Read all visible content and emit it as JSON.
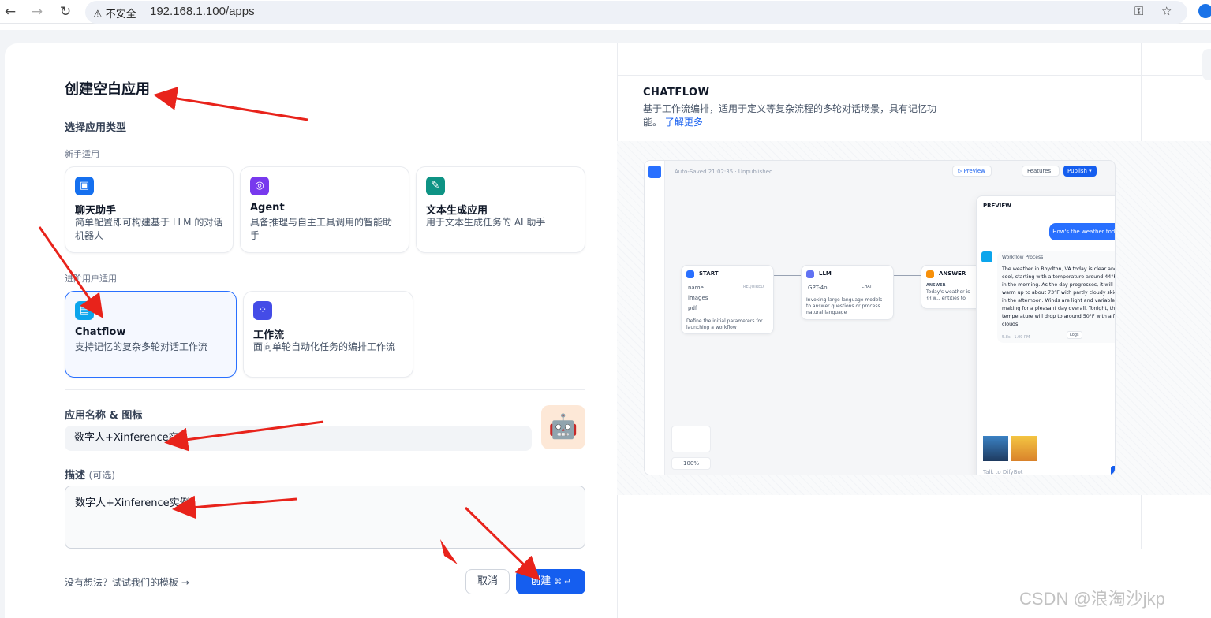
{
  "browser": {
    "warning": "不安全",
    "url": "192.168.1.100/apps"
  },
  "dialog": {
    "title": "创建空白应用",
    "select_type": "选择应用类型",
    "beginner_label": "新手适用",
    "advanced_label": "进阶用户适用",
    "beginner_cards": [
      {
        "title": "聊天助手",
        "desc": "简单配置即可构建基于 LLM 的对话机器人",
        "color": "#1570ef"
      },
      {
        "title": "Agent",
        "desc": "具备推理与自主工具调用的智能助手",
        "color": "#7839ee"
      },
      {
        "title": "文本生成应用",
        "desc": "用于文本生成任务的 AI 助手",
        "color": "#0e9384"
      }
    ],
    "advanced_cards": [
      {
        "title": "Chatflow",
        "desc": "支持记忆的复杂多轮对话工作流",
        "color": "#0ba5ec"
      },
      {
        "title": "工作流",
        "desc": "面向单轮自动化任务的编排工作流",
        "color": "#444ce7"
      }
    ],
    "name_label": "应用名称 & 图标",
    "name_value": "数字人+Xinference实",
    "desc_label": "描述",
    "desc_optional": "(可选)",
    "desc_value": "数字人+Xinference实例",
    "template_link": "没有想法？试试我们的模板 →",
    "cancel": "取消",
    "create": "创建",
    "create_shortcut": "⌘ ↵"
  },
  "preview": {
    "title": "CHATFLOW",
    "desc": "基于工作流编排，适用于定义等复杂流程的多轮对话场景，具有记忆功能。",
    "learn_more": "了解更多",
    "screenshot": {
      "autosaved": "Auto-Saved 21:02:35 · Unpublished",
      "preview_btn": "▷ Preview",
      "features_btn": "Features",
      "publish_btn": "Publish ▾",
      "preview_panel": "PREVIEW",
      "user_msg": "How's the weather today",
      "workflow_process": "Workflow Process",
      "reply": "The weather in Boydton, VA today is clear and cool, starting with a temperature around 44°F in the morning. As the day progresses, it will warm up to about 73°F with partly cloudy skies in the afternoon. Winds are light and variable, making for a pleasant day overall. Tonight, the temperature will drop to around 50°F with a few clouds.",
      "reply_meta": "5.8s · 1.09 PM",
      "logs": "Logs",
      "start": "START",
      "start_fields": [
        "name",
        "images",
        "pdf"
      ],
      "required": "REQUIRED",
      "start_desc": "Define the initial parameters for launching a workflow",
      "llm": "LLM",
      "llm_model": "GPT-4o",
      "chat_tag": "CHAT",
      "llm_desc": "Invoking large language models to answer questions or process natural language",
      "answer": "ANSWER",
      "answer_label": "ANSWER",
      "answer_text": "Today's weather is {{w... entities to extract.",
      "zoom": "100%",
      "chat_placeholder": "Talk to DifyBot"
    }
  },
  "watermark": "CSDN @浪淘沙jkp"
}
